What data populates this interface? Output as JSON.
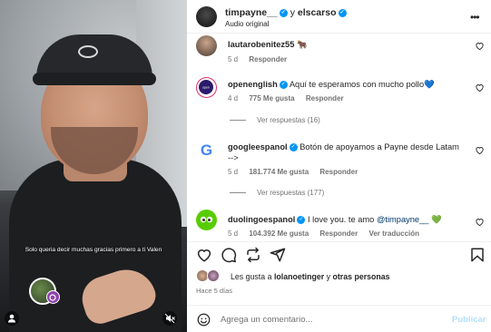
{
  "video": {
    "caption": "Solo queria decir muchas gracias primero a ti Valen",
    "cap_logo_icon": "cap-logo-icon",
    "user_icon": "user-icon",
    "muted_icon": "speaker-muted-icon"
  },
  "header": {
    "author": "timpayne__",
    "connector": "y",
    "coauthor": "elscarso",
    "audio": "Audio original",
    "more_icon": "more-icon"
  },
  "comments": [
    {
      "user": "lautarobenitez55",
      "verified": false,
      "text": "🐂",
      "age": "5 d",
      "likes": "",
      "reply": "Responder",
      "translate": "",
      "replies": ""
    },
    {
      "user": "openenglish",
      "verified": true,
      "text": "Aquí te esperamos con mucho pollo💙",
      "age": "4 d",
      "likes": "775 Me gusta",
      "reply": "Responder",
      "translate": "",
      "replies": "Ver respuestas (16)"
    },
    {
      "user": "googleespanol",
      "verified": true,
      "text": "Botón de apoyamos a Payne desde Latam -->",
      "age": "5 d",
      "likes": "181.774 Me gusta",
      "reply": "Responder",
      "translate": "",
      "replies": "Ver respuestas (177)"
    },
    {
      "user": "duolingoespanol",
      "verified": true,
      "text": "I love you. te amo ",
      "mention": "@timpayne__",
      "emoji": "💚",
      "age": "5 d",
      "likes": "104.392 Me gusta",
      "reply": "Responder",
      "translate": "Ver traducción",
      "replies": ""
    }
  ],
  "actions": {
    "like_icon": "heart-icon",
    "comment_icon": "comment-icon",
    "repost_icon": "repost-icon",
    "share_icon": "share-icon",
    "save_icon": "bookmark-icon"
  },
  "likes": {
    "prefix": "Les gusta a",
    "user": "lolanoetinger",
    "conj": "y",
    "others": "otras personas"
  },
  "date": "Hace 5 días",
  "composer": {
    "placeholder": "Agrega un comentario...",
    "publish": "Publicar",
    "emoji_icon": "emoji-icon"
  },
  "colors": {
    "verified": "#0095f6",
    "link": "#00376b",
    "publish_disabled": "#b2dffc",
    "muted_text": "#737373"
  }
}
